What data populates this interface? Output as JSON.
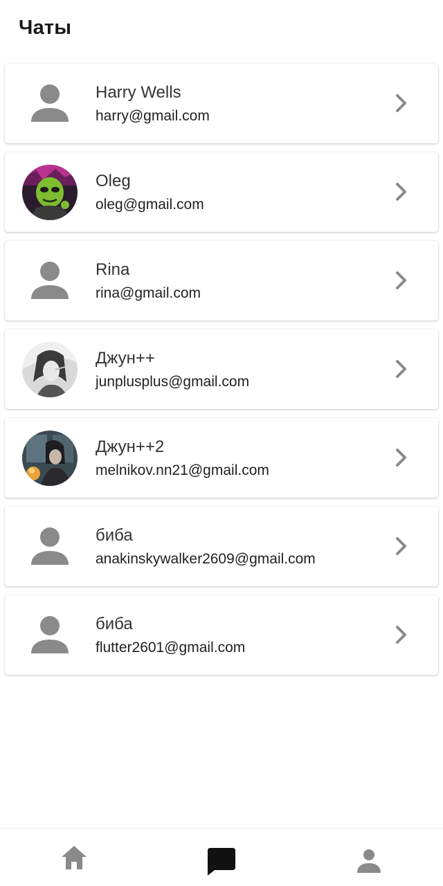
{
  "header": {
    "title": "Чаты"
  },
  "chats": [
    {
      "name": "Harry Wells",
      "email": "harry@gmail.com",
      "avatar": "person-icon"
    },
    {
      "name": "Oleg",
      "email": "oleg@gmail.com",
      "avatar": "photo-green-character"
    },
    {
      "name": "Rina",
      "email": "rina@gmail.com",
      "avatar": "person-icon"
    },
    {
      "name": "Джун++",
      "email": "junplusplus@gmail.com",
      "avatar": "photo-grayscale-anime"
    },
    {
      "name": "Джун++2",
      "email": "melnikov.nn21@gmail.com",
      "avatar": "photo-dark-anime"
    },
    {
      "name": "биба",
      "email": "anakinskywalker2609@gmail.com",
      "avatar": "person-icon"
    },
    {
      "name": "биба",
      "email": "flutter2601@gmail.com",
      "avatar": "person-icon"
    }
  ],
  "bottom_nav": {
    "items": [
      {
        "icon": "home-icon",
        "active": false
      },
      {
        "icon": "chat-icon",
        "active": true
      },
      {
        "icon": "person-icon",
        "active": false
      }
    ]
  },
  "colors": {
    "icon_gray": "#8a8a8a",
    "active_icon": "#111111",
    "text_primary": "#333333"
  }
}
